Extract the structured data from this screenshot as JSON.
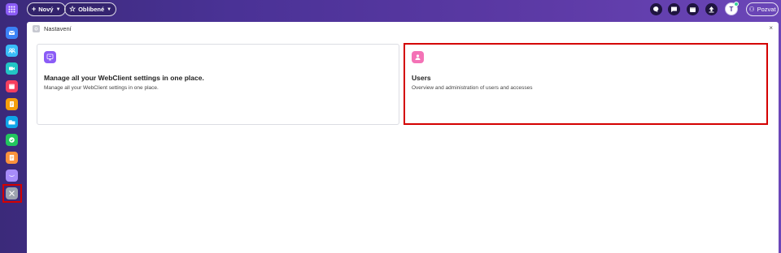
{
  "topbar": {
    "new_label": "Nový",
    "favorites_label": "Oblíbené",
    "invite_label": "Pozvat",
    "avatar_initial": "T"
  },
  "sidebar": {
    "items": [
      {
        "icon": "mail-icon",
        "color": "#3b82f6"
      },
      {
        "icon": "contacts-icon",
        "color": "#38bdf8"
      },
      {
        "icon": "video-icon",
        "color": "#22c5c5"
      },
      {
        "icon": "calendar-icon",
        "color": "#f43f5e"
      },
      {
        "icon": "notes-icon",
        "color": "#f59e0b"
      },
      {
        "icon": "drive-icon",
        "color": "#0ea5e9"
      },
      {
        "icon": "tasks-icon",
        "color": "#22c55e"
      },
      {
        "icon": "documents-icon",
        "color": "#fb923c"
      },
      {
        "icon": "chat-icon",
        "color": "#a78bfa"
      },
      {
        "icon": "settings-tools-icon",
        "color": "#9ca3af"
      }
    ]
  },
  "panel": {
    "title": "Nastavení"
  },
  "cards": [
    {
      "title": "Manage all your WebClient settings in one place.",
      "description": "Manage all your WebClient settings in one place.",
      "icon": "webclient-settings-icon",
      "color": "#8b5cf6"
    },
    {
      "title": "Users",
      "description": "Overview and administration of users and accesses",
      "icon": "user-icon",
      "color": "#f472b6"
    }
  ]
}
